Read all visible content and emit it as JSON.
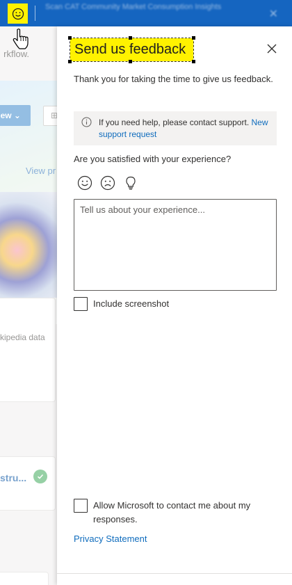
{
  "topbar": {
    "feedback_icon": "smiley-icon",
    "blurred_title": "Scan CAT Community Market Consumption Insights",
    "close_glyph": "✕"
  },
  "background": {
    "workflow_text": "rkflow.",
    "new_button_label": "ew ⌄",
    "view_link": "View pr",
    "wiki_text": "kipedia data",
    "card_title": "stru..."
  },
  "panel": {
    "title": "Send us feedback",
    "close_icon": "close-icon",
    "thanks_text": "Thank you for taking the time to give us feedback.",
    "info": {
      "icon": "info-icon",
      "text": "If you need help, please contact support.",
      "link": "New support request"
    },
    "question": "Are you satisfied with your experience?",
    "faces": [
      {
        "name": "satisfied",
        "icon": "smile-icon"
      },
      {
        "name": "dissatisfied",
        "icon": "frown-icon"
      },
      {
        "name": "suggestion",
        "icon": "lightbulb-icon"
      }
    ],
    "textarea_placeholder": "Tell us about your experience...",
    "include_screenshot_label": "Include screenshot",
    "contact_label": "Allow Microsoft to contact me about my responses.",
    "privacy_link": "Privacy Statement"
  },
  "colors": {
    "topbar": "#1565c0",
    "highlight": "#fff200",
    "link": "#0f6cbd",
    "verified": "#5fb776"
  }
}
